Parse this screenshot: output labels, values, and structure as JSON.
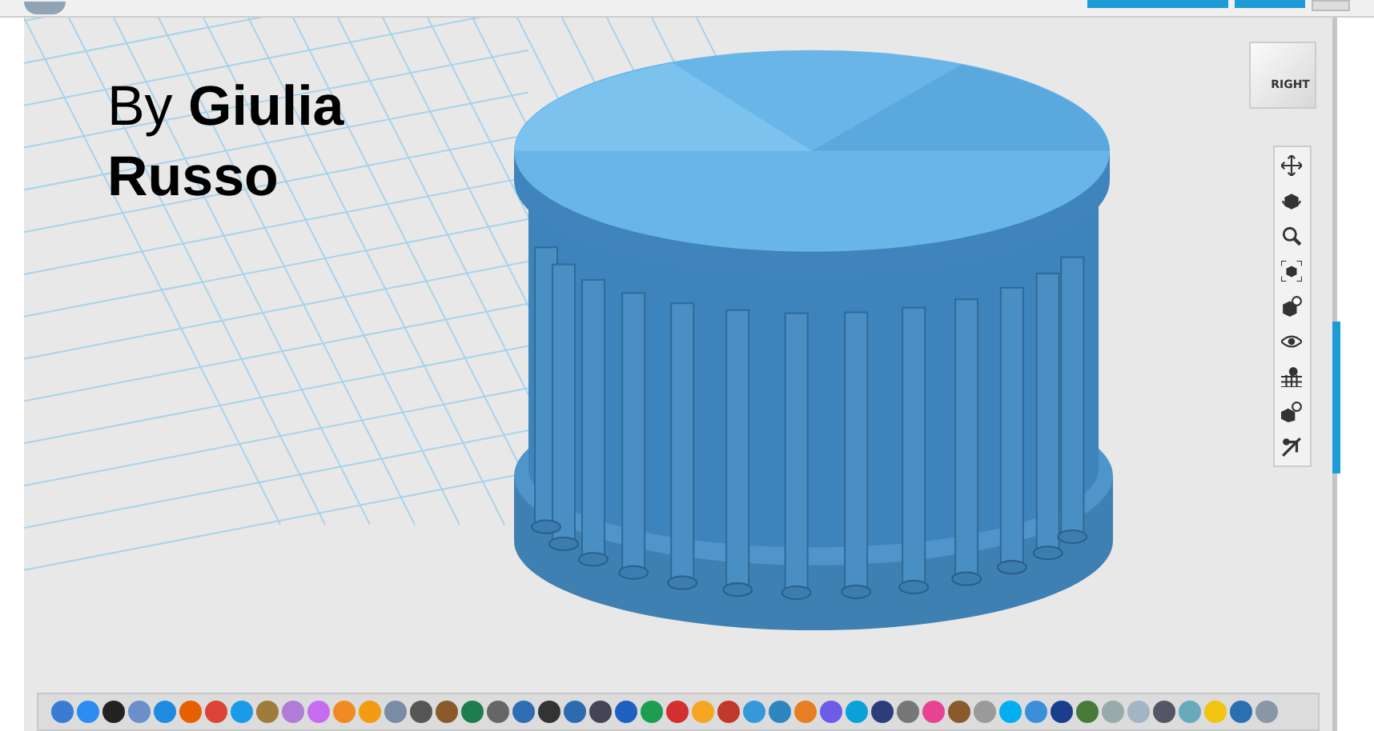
{
  "caption": "By **Giulia Russo**",
  "view_cube": {
    "face_label": "RIGHT"
  }
}
